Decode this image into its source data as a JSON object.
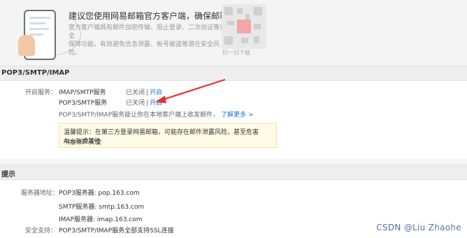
{
  "promo": {
    "title": "建议您使用网易邮箱官方客户端，确保邮箱安全",
    "desc_line1": "官方客户端具有邮件加密传输、阻止登录、二次验证等安全",
    "desc_line2": "保障功能，有效避免信息泄露、帐号被盗等潜在安全风险。",
    "qr_caption": "扫一扫下载"
  },
  "pop_section": {
    "title": "POP3/SMTP/IMAP",
    "open_service_label": "开启服务：",
    "services": [
      {
        "name": "IMAP/SMTP服务",
        "status": "已关闭",
        "action": "开启"
      },
      {
        "name": "POP3/SMTP服务",
        "status": "已关闭",
        "action": "开启"
      }
    ],
    "info_text": "POP3/SMTP/IMAP服务能让你在本地客户端上收发邮件，",
    "learn_more": "了解更多 >",
    "tip_line1": "温馨提示：在第三方登录网易邮箱，可能存在邮件泄露风险，甚至危害Apple或其他",
    "tip_line2": "平台账户安全"
  },
  "tip_section": {
    "title": "提示",
    "server_label": "服务器地址：",
    "servers": [
      "POP3服务器: pop.163.com",
      "SMTP服务器: smtp.163.com",
      "IMAP服务器: imap.163.com"
    ],
    "security_label": "安全支持：",
    "security_text": "POP3/SMTP/IMAP服务全部支持SSL连接"
  },
  "watermark": "CSDN @Liu Zhaohe",
  "colors": {
    "link": "#1f6fd1",
    "arrow": "#e8332f",
    "tip_bg": "#fffbe6"
  }
}
